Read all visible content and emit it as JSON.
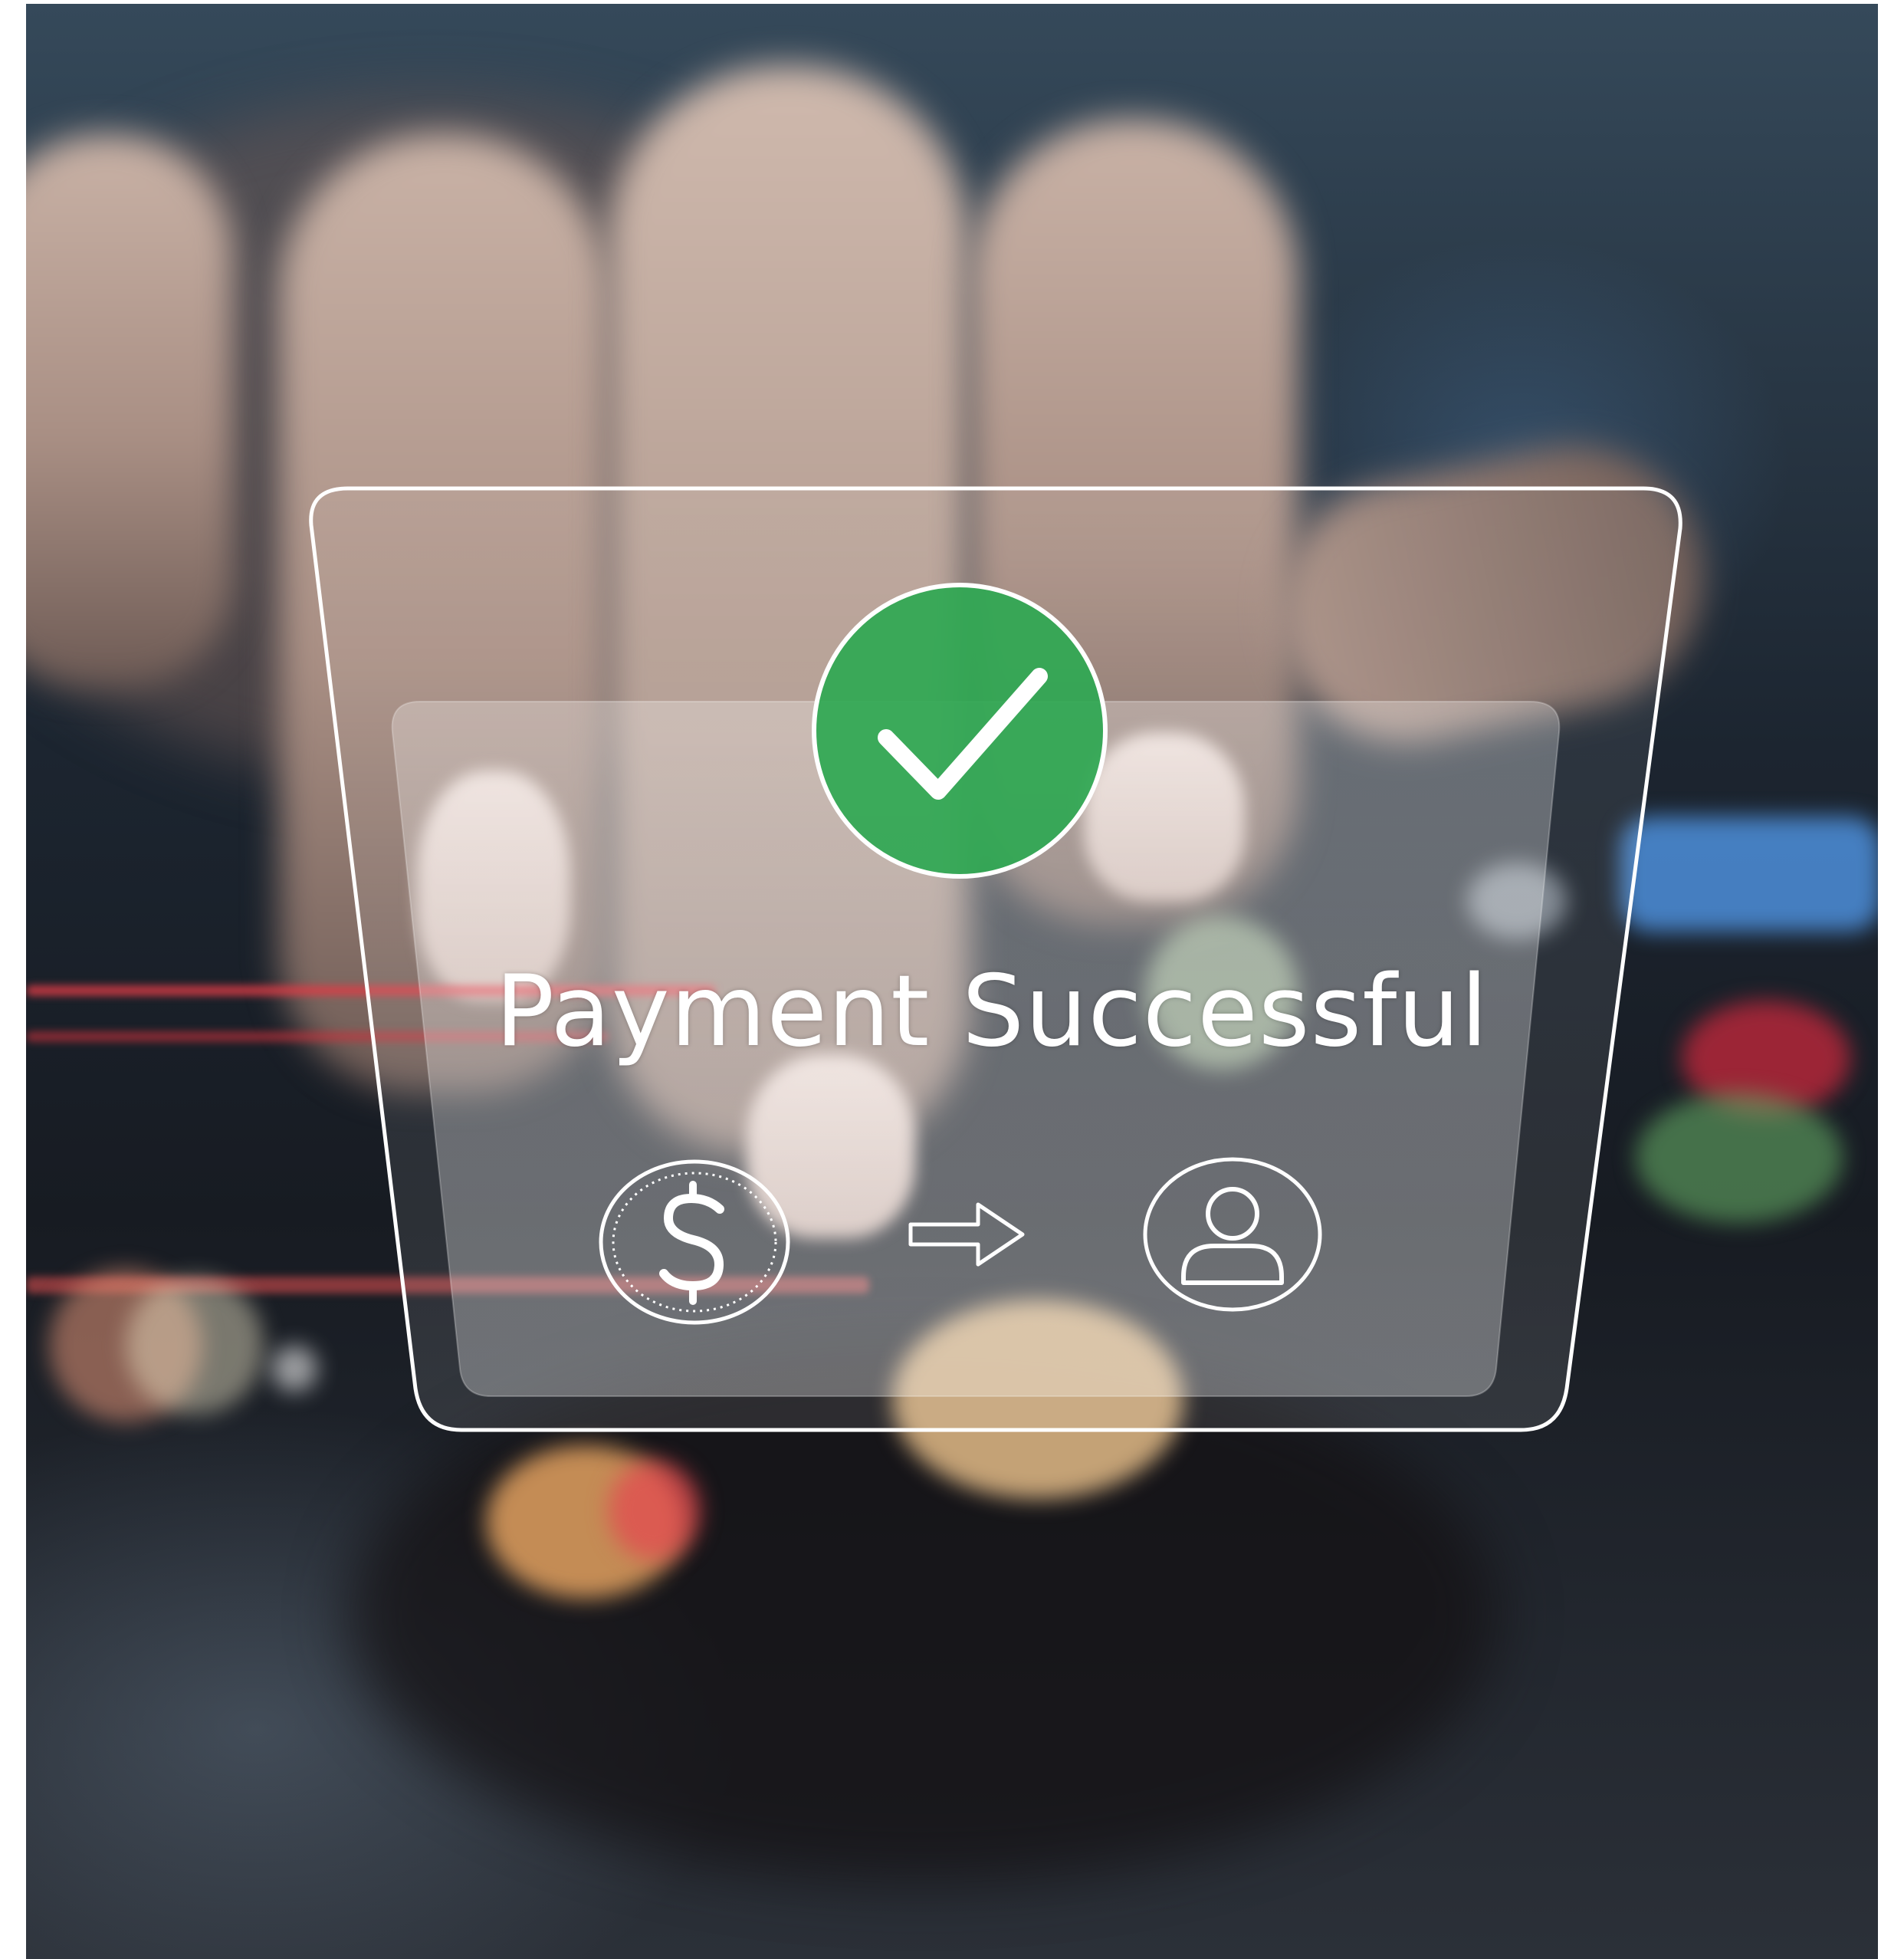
{
  "card": {
    "title": "Payment Successful"
  },
  "icons": {
    "status": "checkmark-icon",
    "source": "dollar-coin-icon",
    "direction": "arrow-right-icon",
    "recipient": "user-profile-icon"
  },
  "colors": {
    "success_green": "#2fa852",
    "panel_border": "#ffffff"
  }
}
